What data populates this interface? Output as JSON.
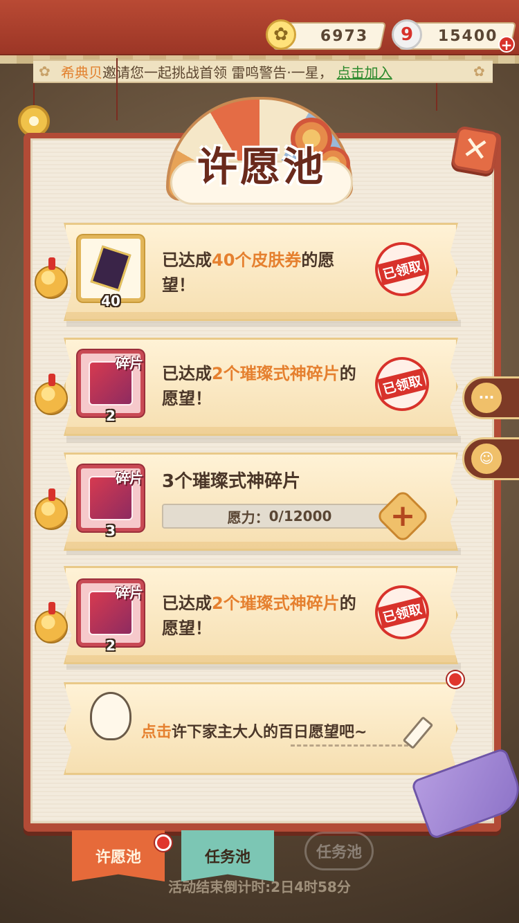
{
  "currency": {
    "coins": "6973",
    "jade": "15400",
    "jade_badge": "9",
    "coin_icon": "✿",
    "add_icon": "+"
  },
  "notice": {
    "name": "希典贝",
    "text": "邀请您一起挑战首领 雷鸣警告·一星，",
    "link": "点击加入"
  },
  "title": "许愿池",
  "close_icon": "✕",
  "cards": [
    {
      "icon": "skin-ticket",
      "qty": "40",
      "text_prefix": "已达成",
      "highlight": "40个皮肤券",
      "text_suffix": "的愿望！",
      "stamp": "已领取"
    },
    {
      "icon": "shard",
      "icon_label": "碎片",
      "qty": "2",
      "text_prefix": "已达成",
      "highlight": "2个璀璨式神碎片",
      "text_suffix": "的愿望！",
      "stamp": "已领取"
    },
    {
      "icon": "shard",
      "icon_label": "碎片",
      "qty": "3",
      "title": "3个璀璨式神碎片",
      "progress_label": "愿力：",
      "progress_current": 0,
      "progress_total": 12000,
      "progress_text": "0/12000",
      "plus": "+"
    },
    {
      "icon": "shard",
      "icon_label": "碎片",
      "qty": "2",
      "text_prefix": "已达成",
      "highlight": "2个璀璨式神碎片",
      "text_suffix": "的愿望！",
      "stamp": "已领取"
    }
  ],
  "wish_prompt": {
    "highlight": "点击",
    "text": "许下家主大人的百日愿望吧~"
  },
  "side_buttons": {
    "chat": "···",
    "mascot": "☺"
  },
  "tabs": {
    "wish": "许愿池",
    "task": "任务池",
    "task_bg": "任务池"
  },
  "countdown": "活动结束倒计时:2日4时58分",
  "colors": {
    "accent": "#e5802f",
    "frame": "#b24b36",
    "stamp_red": "#d8322b"
  }
}
